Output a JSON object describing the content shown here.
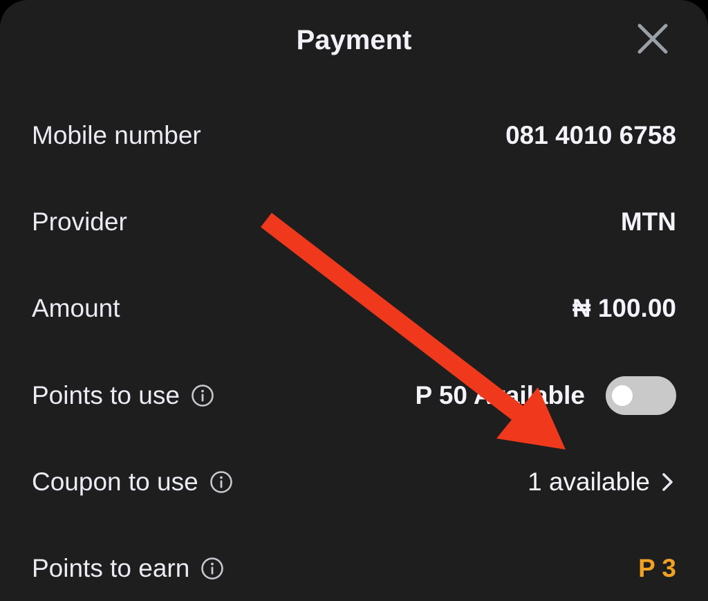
{
  "header": {
    "title": "Payment"
  },
  "rows": {
    "mobile": {
      "label": "Mobile number",
      "value": "081 4010 6758"
    },
    "provider": {
      "label": "Provider",
      "value": "MTN"
    },
    "amount": {
      "label": "Amount",
      "value": "₦ 100.00"
    },
    "points_use": {
      "label": "Points to use",
      "value": "P 50 Available",
      "toggle_on": false
    },
    "coupon": {
      "label": "Coupon to use",
      "value": "1 available"
    },
    "points_earn": {
      "label": "Points to earn",
      "value": "P 3"
    }
  },
  "icons": {
    "close": "close-icon",
    "info": "info-icon",
    "chevron": "chevron-right-icon"
  },
  "colors": {
    "background": "#1e1e1e",
    "text": "#eceaf3",
    "points_earn": "#f2a122",
    "toggle_track": "#c9c9c9",
    "annotation_arrow": "#f0391c"
  }
}
